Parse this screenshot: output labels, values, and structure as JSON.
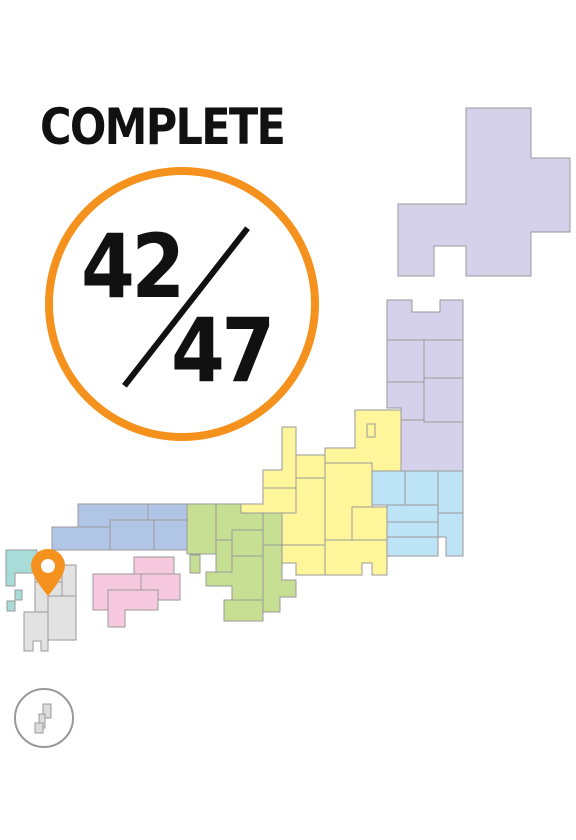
{
  "header": {
    "title": "COMPLETE"
  },
  "progress": {
    "completed": "42",
    "total": "47",
    "fraction": 0.8936
  },
  "colors": {
    "accent_orange": "#f5921e",
    "hokkaido_tohoku": "#d6d1ea",
    "kanto": "#bde3f7",
    "chubu": "#fff59a",
    "kinki": "#c6df93",
    "chugoku": "#b1c6e7",
    "shikoku": "#f6c9df",
    "kyushu": "#e2e2e2",
    "okinawa_teal": "#a8dcd8"
  },
  "icons": {
    "location_pin": "map-pin-icon",
    "mini_map": "japan-mini-map-icon"
  }
}
